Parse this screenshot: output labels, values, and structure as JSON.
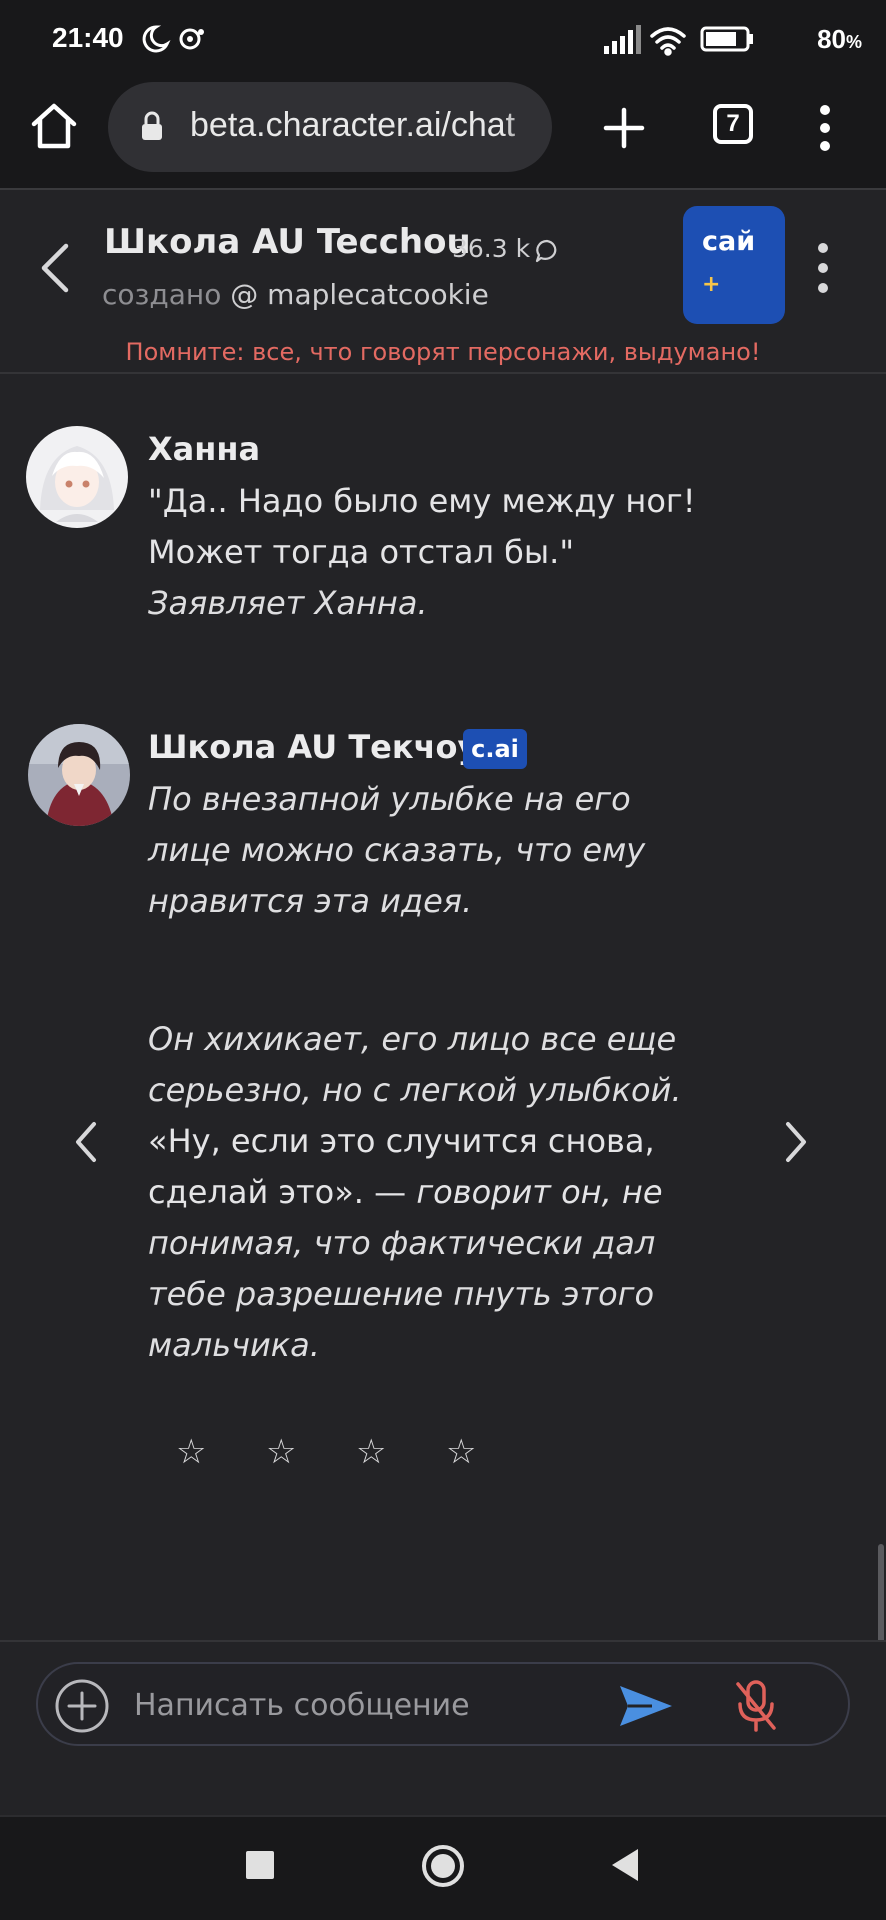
{
  "status_bar": {
    "time": "21:40",
    "battery_percent": "80",
    "battery_unit": "%",
    "icons": [
      "moon-icon",
      "notification-icon",
      "signal-icon",
      "wifi-icon",
      "battery-icon"
    ]
  },
  "browser": {
    "url": "beta.character.ai/chat",
    "tab_count": "7"
  },
  "chat_header": {
    "title": "Школа AU Tecchou",
    "chat_count": "36.3 k",
    "creator_label": "создано",
    "creator_handle": "@ maplecatcookie",
    "plus_badge_label": "сай",
    "plus_badge_symbol": "+",
    "disclaimer": "Помните: все, что говорят персонажи, выдумано!"
  },
  "messages": [
    {
      "author": "Ханна",
      "lines": [
        "\"Да.. Надо было ему между ног!",
        "Может тогда отстал бы.\"",
        "Заявляет Ханна."
      ]
    },
    {
      "author": "Школа AU Текчоу",
      "badge": "c.ai",
      "lines": [
        "По внезапной улыбке на его",
        "лице можно сказать, что ему",
        "нравится эта идея.",
        "Он хихикает, его лицо все еще",
        "серьезно, но с легкой улыбкой.",
        "«Ну, если это случится снова,",
        "сделай это». —",
        "говорит он, не",
        "понимая, что фактически дал",
        "тебе разрешение пнуть этого",
        "мальчика."
      ],
      "rating_stars": [
        "☆",
        "☆",
        "☆",
        "☆"
      ]
    }
  ],
  "composer": {
    "placeholder": "Написать сообщение"
  },
  "colors": {
    "background": "#232326",
    "bar_background": "#18181a",
    "accent_blue": "#1d4fb3",
    "send_blue": "#4a8fe0",
    "disclaimer_red": "#e36a62",
    "mic_red": "#e0615a"
  }
}
